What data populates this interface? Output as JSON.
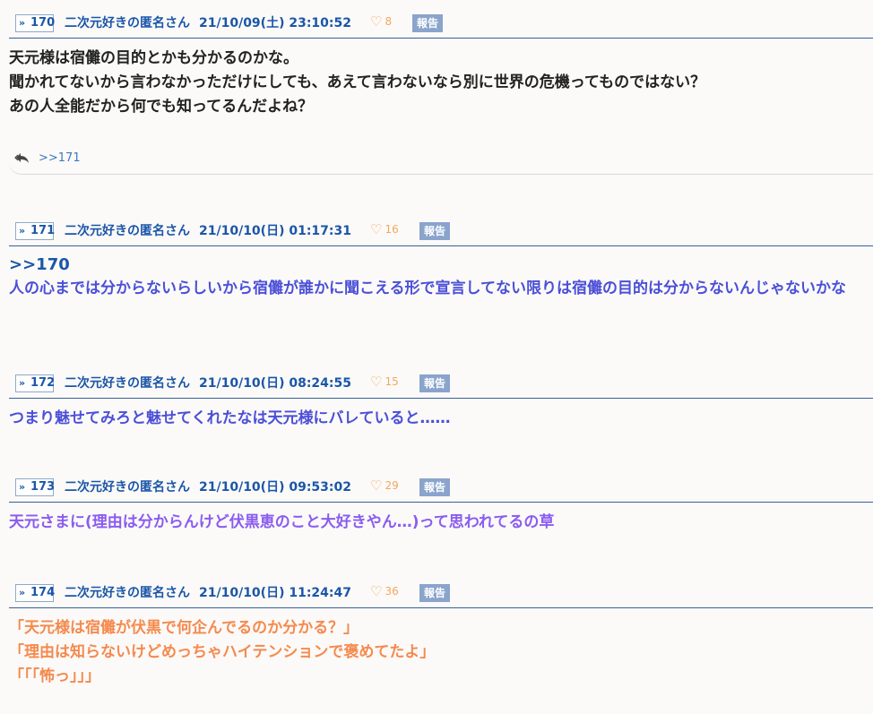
{
  "colors": {
    "header_blue": "#1b56a8",
    "rule": "#3b5f93",
    "like_orange": "#f0a860",
    "report_bg": "#8aa4cc",
    "text_black": "#222222",
    "text_blue_violet": "#4b4fd8",
    "text_purple": "#8a5cf0",
    "text_orange": "#f58a4e"
  },
  "icons": {
    "post_num_arrow": "double-chevron-right-icon",
    "like": "heart-outline-icon",
    "reply": "reply-arrow-icon"
  },
  "posts": [
    {
      "num": "170",
      "name": "二次元好きの匿名さん",
      "date": "21/10/09(土) 23:10:52",
      "likes": "8",
      "report": "報告",
      "body_color": "#222222",
      "anchor": "",
      "lines": [
        "天元様は宿儺の目的とかも分かるのかな。",
        "聞かれてないから言わなかっただけにしても、あえて言わないなら別に世界の危機ってものではない？",
        "あの人全能だから何でも知ってるんだよね？"
      ],
      "reply_link": ">>171"
    },
    {
      "num": "171",
      "name": "二次元好きの匿名さん",
      "date": "21/10/10(日) 01:17:31",
      "likes": "16",
      "report": "報告",
      "body_color": "#4b4fd8",
      "anchor": ">>170",
      "lines": [
        "人の心までは分からないらしいから宿儺が誰かに聞こえる形で宣言してない限りは宿儺の目的は分からないんじゃないかな"
      ]
    },
    {
      "num": "172",
      "name": "二次元好きの匿名さん",
      "date": "21/10/10(日) 08:24:55",
      "likes": "15",
      "report": "報告",
      "body_color": "#4b4fd8",
      "anchor": "",
      "lines": [
        "つまり魅せてみろと魅せてくれたなは天元様にバレていると……"
      ]
    },
    {
      "num": "173",
      "name": "二次元好きの匿名さん",
      "date": "21/10/10(日) 09:53:02",
      "likes": "29",
      "report": "報告",
      "body_color": "#8a5cf0",
      "anchor": "",
      "lines": [
        "天元さまに(理由は分からんけど伏黒恵のこと大好きやん…)って思われてるの草"
      ]
    },
    {
      "num": "174",
      "name": "二次元好きの匿名さん",
      "date": "21/10/10(日) 11:24:47",
      "likes": "36",
      "report": "報告",
      "body_color": "#f58a4e",
      "anchor": "",
      "lines": [
        "「天元様は宿儺が伏黒で何企んでるのか分かる？」",
        "「理由は知らないけどめっちゃハイテンションで褒めてたよ」",
        "「「「怖っ」」」"
      ]
    }
  ]
}
